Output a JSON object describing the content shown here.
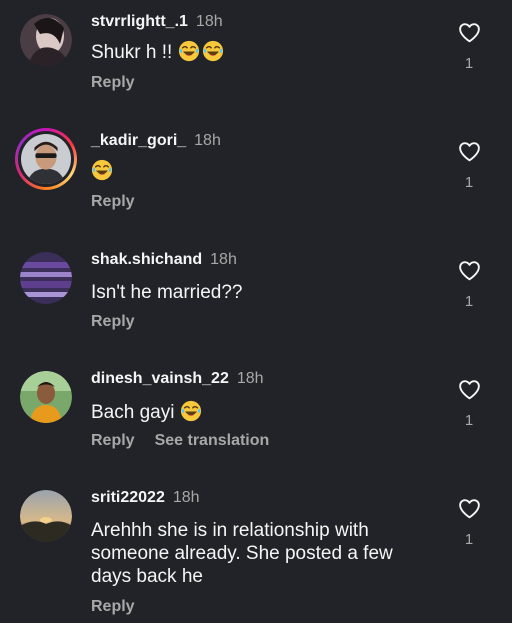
{
  "colors": {
    "background": "#212328",
    "text_primary": "#f5f5f5",
    "text_secondary": "#a8a8a8"
  },
  "comments": [
    {
      "username": "stvrrlightt_.1",
      "time": "18h",
      "text": "Shukr h !!",
      "emojis": [
        "joy-emoji",
        "joy-emoji"
      ],
      "reply_label": "Reply",
      "likes": "1"
    },
    {
      "username": "_kadir_gori_",
      "time": "18h",
      "text": "",
      "emojis": [
        "joy-emoji"
      ],
      "reply_label": "Reply",
      "likes": "1"
    },
    {
      "username": "shak.shichand",
      "time": "18h",
      "text": "Isn't he married??",
      "emojis": [],
      "reply_label": "Reply",
      "likes": "1"
    },
    {
      "username": "dinesh_vainsh_22",
      "time": "18h",
      "text": "Bach gayi",
      "emojis": [
        "joy-emoji"
      ],
      "reply_label": "Reply",
      "translate_label": "See translation",
      "likes": "1"
    },
    {
      "username": "sriti22022",
      "time": "18h",
      "text": "Arehhh she is in relationship with someone already. She posted a few days back he",
      "emojis": [],
      "reply_label": "Reply",
      "likes": "1"
    }
  ],
  "icons": {
    "like": "heart-outline-icon",
    "emoji": "face-with-tears-of-joy"
  }
}
